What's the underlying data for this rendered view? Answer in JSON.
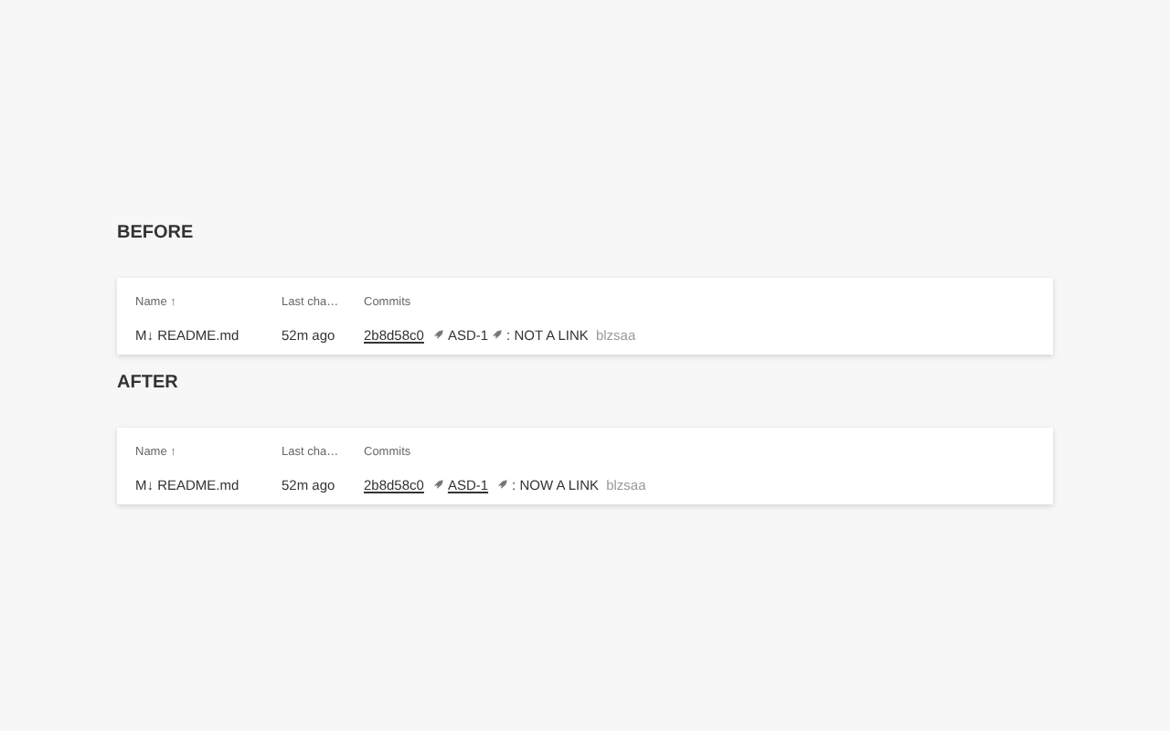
{
  "sections": [
    {
      "title": "BEFORE",
      "table": {
        "columns": [
          "Name ↑",
          "Last cha…",
          "Commits"
        ],
        "rows": [
          {
            "name": "M↓ README.md",
            "changed": "52m ago",
            "hash": "2b8d58c0",
            "ticket": "ASD-1",
            "ticket_link": false,
            "message": ": NOT A LINK",
            "author": "blzsaa"
          }
        ]
      }
    },
    {
      "title": "AFTER",
      "table": {
        "columns": [
          "Name ↑",
          "Last cha…",
          "Commits"
        ],
        "rows": [
          {
            "name": "M↓ README.md",
            "changed": "52m ago",
            "hash": "2b8d58c0",
            "ticket": "ASD-1",
            "ticket_link": true,
            "message": ": NOW A LINK",
            "author": "blzsaa"
          }
        ]
      }
    }
  ]
}
